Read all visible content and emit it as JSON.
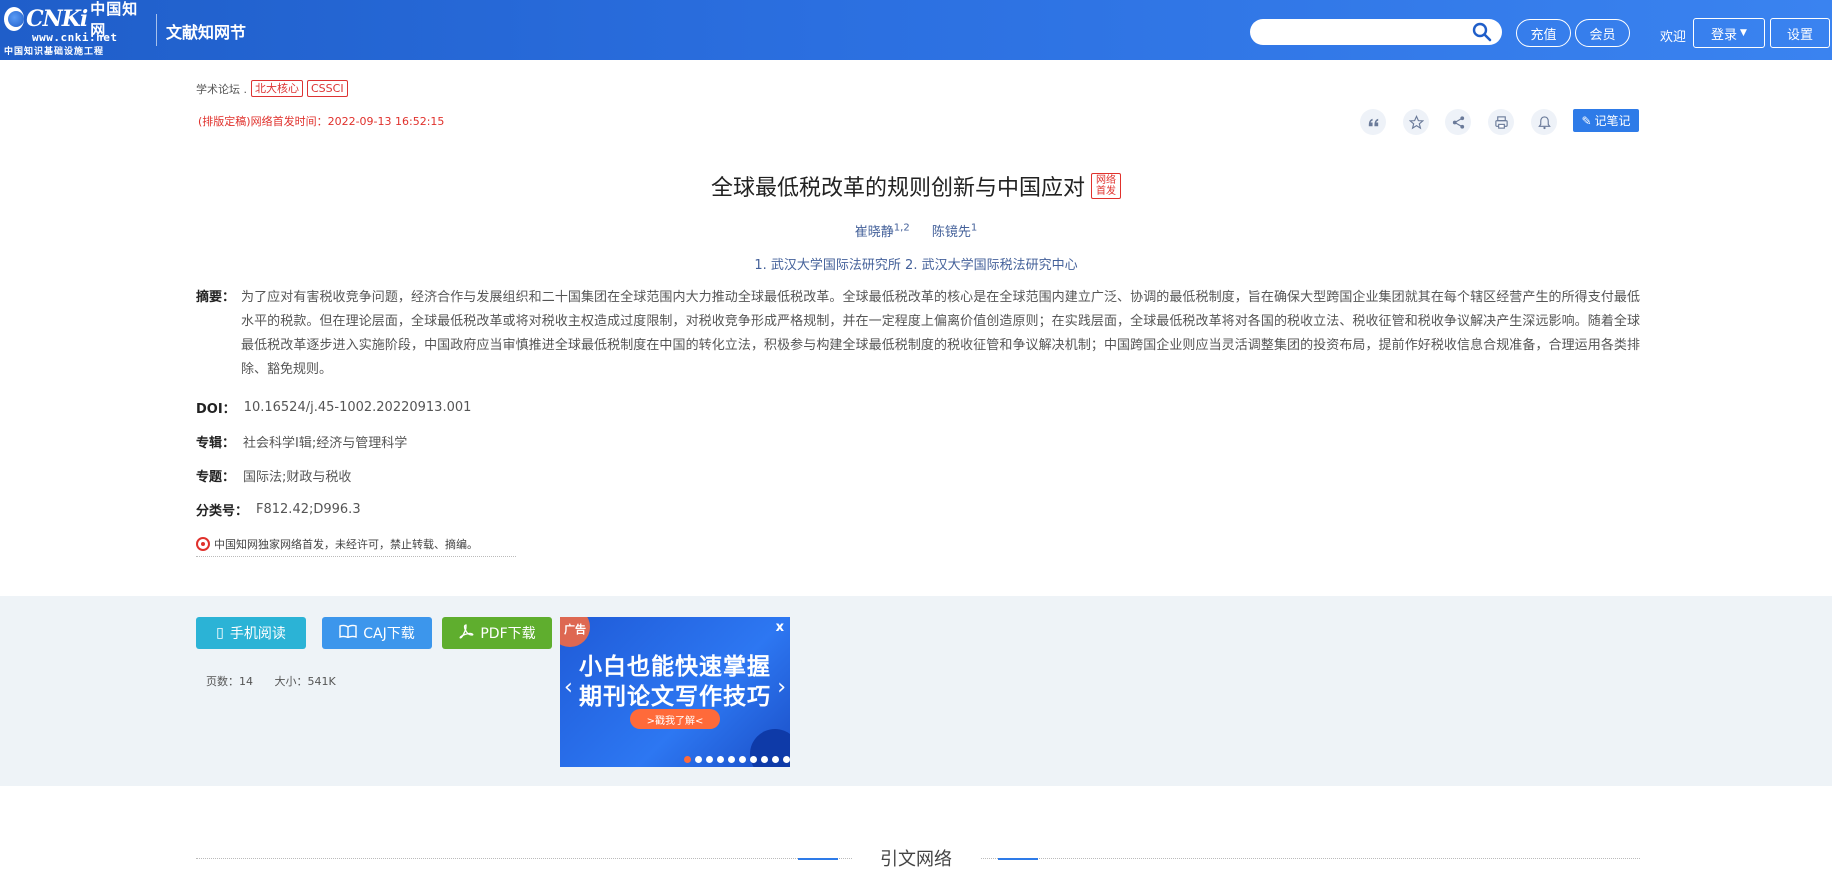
{
  "header": {
    "logo_cnki": "CNKi",
    "logo_cn": "中国知网",
    "logo_url": "www.cnki.net",
    "logo_sub": "中国知识基础设施工程",
    "section": "文献知网节",
    "search_placeholder": "",
    "recharge": "充值",
    "member": "会员",
    "welcome": "欢迎",
    "login": "登录",
    "settings": "设置",
    "colors": {
      "bar": "#2b6fe0",
      "accent": "#2e7be8"
    }
  },
  "meta": {
    "journal": "学术论坛 .",
    "tags": [
      "北大核心",
      "CSSCI"
    ],
    "pubtime": "(排版定稿)网络首发时间：2022-09-13 16:52:15",
    "note_btn": "记笔记"
  },
  "article": {
    "title": "全球最低税改革的规则创新与中国应对",
    "badge_line1": "网络",
    "badge_line2": "首发",
    "authors": [
      {
        "name": "崔晓静",
        "sup": "1,2"
      },
      {
        "name": "陈镜先",
        "sup": "1"
      }
    ],
    "affiliations": "1. 武汉大学国际法研究所   2. 武汉大学国际税法研究中心",
    "abstract_label": "摘要：",
    "abstract": "为了应对有害税收竞争问题，经济合作与发展组织和二十国集团在全球范围内大力推动全球最低税改革。全球最低税改革的核心是在全球范围内建立广泛、协调的最低税制度，旨在确保大型跨国企业集团就其在每个辖区经营产生的所得支付最低水平的税款。但在理论层面，全球最低税改革或将对税收主权造成过度限制，对税收竞争形成严格规制，并在一定程度上偏离价值创造原则；在实践层面，全球最低税改革将对各国的税收立法、税收征管和税收争议解决产生深远影响。随着全球最低税改革逐步进入实施阶段，中国政府应当审慎推进全球最低税制度在中国的转化立法，积极参与构建全球最低税制度的税收征管和争议解决机制；中国跨国企业则应当灵活调整集团的投资布局，提前作好税收信息合规准备，合理运用各类排除、豁免规则。",
    "doi_label": "DOI：",
    "doi": "10.16524/j.45-1002.20220913.001",
    "series_label": "专辑：",
    "series": "社会科学Ⅰ辑;经济与管理科学",
    "topic_label": "专题：",
    "topic": "国际法;财政与税收",
    "class_label": "分类号：",
    "class": "F812.42;D996.3",
    "exclusive": "中国知网独家网络首发，未经许可，禁止转载、摘编。"
  },
  "downloads": {
    "mobile": "手机阅读",
    "caj": "CAJ下载",
    "pdf": "PDF下载",
    "pages": "页数：14",
    "size": "大小：541K",
    "colors": {
      "mobile": "#2bb3d6",
      "caj": "#3c96ec",
      "pdf": "#5fae2e"
    }
  },
  "ad": {
    "label": "广告",
    "close": "x",
    "line1": "小白也能快速掌握",
    "line2": "期刊论文写作技巧",
    "cta": ">戳我了解<",
    "prev": "‹",
    "next": "›"
  },
  "network": {
    "title": "引文网络"
  }
}
